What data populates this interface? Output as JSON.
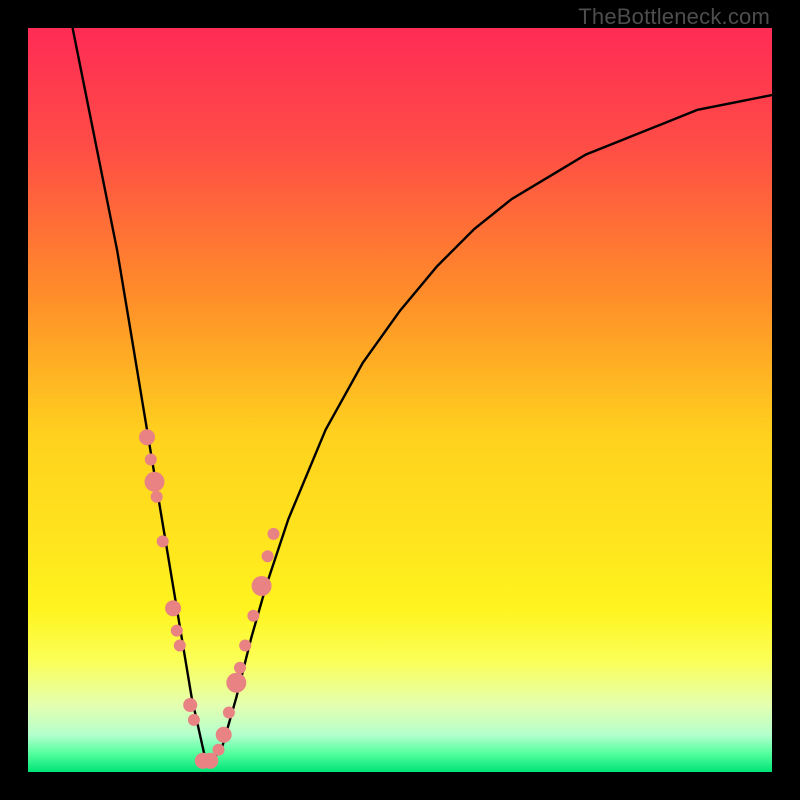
{
  "watermark": "TheBottleneck.com",
  "colors": {
    "frame": "#000000",
    "gradient_stops": [
      {
        "offset": 0.0,
        "color": "#ff2b55"
      },
      {
        "offset": 0.16,
        "color": "#ff4d46"
      },
      {
        "offset": 0.35,
        "color": "#ff8a2a"
      },
      {
        "offset": 0.55,
        "color": "#ffd21e"
      },
      {
        "offset": 0.7,
        "color": "#ffe61e"
      },
      {
        "offset": 0.78,
        "color": "#fff41e"
      },
      {
        "offset": 0.85,
        "color": "#fbff57"
      },
      {
        "offset": 0.91,
        "color": "#e4ffb0"
      },
      {
        "offset": 0.95,
        "color": "#b4ffcd"
      },
      {
        "offset": 0.975,
        "color": "#55ff9e"
      },
      {
        "offset": 1.0,
        "color": "#00e477"
      }
    ],
    "curve": "#000000",
    "marker_fill": "#e98383",
    "marker_stroke": "#c56767"
  },
  "chart_data": {
    "type": "line",
    "title": "",
    "xlabel": "",
    "ylabel": "",
    "xlim": [
      0,
      100
    ],
    "ylim": [
      0,
      100
    ],
    "grid": false,
    "note": "U-shaped bottleneck curve; y-axis inverted visually (0 at bottom = best). Minimum bottleneck near x≈24.",
    "series": [
      {
        "name": "bottleneck-curve",
        "x": [
          6,
          8,
          10,
          12,
          14,
          16,
          18,
          20,
          22,
          24,
          26,
          28,
          30,
          32,
          35,
          40,
          45,
          50,
          55,
          60,
          65,
          70,
          75,
          80,
          85,
          90,
          95,
          100
        ],
        "values": [
          100,
          90,
          80,
          70,
          58,
          46,
          34,
          22,
          10,
          1,
          3,
          10,
          18,
          25,
          34,
          46,
          55,
          62,
          68,
          73,
          77,
          80,
          83,
          85,
          87,
          89,
          90,
          91
        ]
      }
    ],
    "markers": {
      "name": "sample-points",
      "x": [
        16.0,
        16.5,
        17.0,
        17.3,
        18.1,
        19.5,
        20.0,
        20.4,
        21.8,
        22.3,
        23.5,
        24.5,
        25.6,
        26.3,
        27.0,
        28.0,
        28.5,
        29.2,
        30.3,
        31.4,
        32.2,
        33.0
      ],
      "values": [
        45,
        42,
        39,
        37,
        31,
        22,
        19,
        17,
        9,
        7,
        1.5,
        1.5,
        3,
        5,
        8,
        12,
        14,
        17,
        21,
        25,
        29,
        32
      ],
      "radii": [
        8,
        6,
        10,
        6,
        6,
        8,
        6,
        6,
        7,
        6,
        8,
        8,
        6,
        8,
        6,
        10,
        6,
        6,
        6,
        10,
        6,
        6
      ]
    }
  }
}
